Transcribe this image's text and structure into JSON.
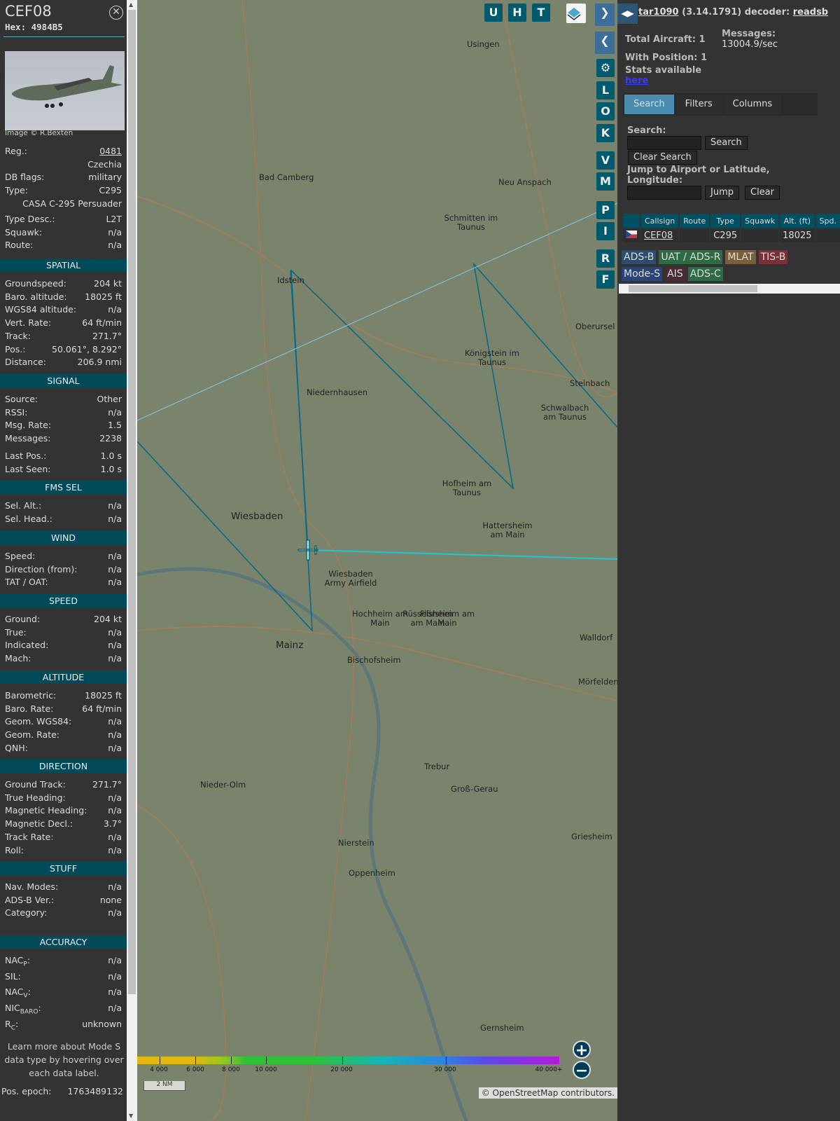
{
  "aircraft": {
    "callsign": "CEF08",
    "hex": "Hex: 4984B5",
    "image_credit": "Image © R.Bexten",
    "header_rows": [
      {
        "label": "Reg.:",
        "value": "0481",
        "link": true
      },
      {
        "label": "",
        "value": "Czechia"
      },
      {
        "label": "DB flags:",
        "value": "military"
      },
      {
        "label": "Type:",
        "value": "C295"
      },
      {
        "label": "",
        "value": "CASA C-295 Persuader"
      },
      {
        "label": "Type Desc.:",
        "value": "L2T"
      },
      {
        "label": "Squawk:",
        "value": "n/a"
      },
      {
        "label": "Route:",
        "value": "n/a"
      }
    ],
    "sections": [
      {
        "title": "SPATIAL",
        "rows": [
          {
            "label": "Groundspeed:",
            "value": "204 kt"
          },
          {
            "label": "Baro. altitude:",
            "value": "18025 ft"
          },
          {
            "label": "WGS84 altitude:",
            "value": "n/a"
          },
          {
            "label": "Vert. Rate:",
            "value": "64 ft/min"
          },
          {
            "label": "Track:",
            "value": "271.7°"
          },
          {
            "label": "Pos.:",
            "value": "50.061°, 8.292°"
          },
          {
            "label": "Distance:",
            "value": "206.9 nmi"
          }
        ]
      },
      {
        "title": "SIGNAL",
        "rows": [
          {
            "label": "Source:",
            "value": "Other"
          },
          {
            "label": "RSSI:",
            "value": "n/a"
          },
          {
            "label": "Msg. Rate:",
            "value": "1.5"
          },
          {
            "label": "Messages:",
            "value": "2238"
          },
          {
            "label": "Last Pos.:",
            "value": "1.0 s"
          },
          {
            "label": "Last Seen:",
            "value": "1.0 s"
          }
        ]
      },
      {
        "title": "FMS SEL",
        "rows": [
          {
            "label": "Sel. Alt.:",
            "value": "n/a"
          },
          {
            "label": "Sel. Head.:",
            "value": "n/a"
          }
        ]
      },
      {
        "title": "WIND",
        "rows": [
          {
            "label": "Speed:",
            "value": "n/a"
          },
          {
            "label": "Direction (from):",
            "value": "n/a"
          },
          {
            "label": "TAT / OAT:",
            "value": "n/a"
          }
        ]
      },
      {
        "title": "SPEED",
        "rows": [
          {
            "label": "Ground:",
            "value": "204 kt"
          },
          {
            "label": "True:",
            "value": "n/a"
          },
          {
            "label": "Indicated:",
            "value": "n/a"
          },
          {
            "label": "Mach:",
            "value": "n/a"
          }
        ]
      },
      {
        "title": "ALTITUDE",
        "rows": [
          {
            "label": "Barometric:",
            "value": "18025 ft"
          },
          {
            "label": "Baro. Rate:",
            "value": "64 ft/min"
          },
          {
            "label": "Geom. WGS84:",
            "value": "n/a"
          },
          {
            "label": "Geom. Rate:",
            "value": "n/a"
          },
          {
            "label": "QNH:",
            "value": "n/a"
          }
        ]
      },
      {
        "title": "DIRECTION",
        "rows": [
          {
            "label": "Ground Track:",
            "value": "271.7°"
          },
          {
            "label": "True Heading:",
            "value": "n/a"
          },
          {
            "label": "Magnetic Heading:",
            "value": "n/a"
          },
          {
            "label": "Magnetic Decl.:",
            "value": "3.7°"
          },
          {
            "label": "Track Rate:",
            "value": "n/a"
          },
          {
            "label": "Roll:",
            "value": "n/a"
          }
        ]
      },
      {
        "title": "STUFF",
        "rows": [
          {
            "label": "Nav. Modes:",
            "value": "n/a"
          },
          {
            "label": "ADS-B Ver.:",
            "value": "none"
          },
          {
            "label": "Category:",
            "value": "n/a"
          }
        ]
      },
      {
        "title": "ACCURACY",
        "rows": [
          {
            "label": "NAC",
            "sub": "P",
            "value": "n/a"
          },
          {
            "label": "SIL:",
            "value": "n/a"
          },
          {
            "label": "NAC",
            "sub": "V",
            "value": "n/a"
          },
          {
            "label": "NIC",
            "sub": "BARO",
            "value": "n/a"
          },
          {
            "label": "R",
            "sub": "C",
            "value": "unknown"
          }
        ]
      }
    ],
    "learn_more": "Learn more about Mode S data type by hovering over each data label.",
    "pos_epoch_label": "Pos. epoch:",
    "pos_epoch_value": "1763489132"
  },
  "map": {
    "top_buttons": [
      "U",
      "H",
      "T"
    ],
    "side_buttons": [
      "L",
      "O",
      "K",
      "V",
      "M",
      "P",
      "I",
      "R",
      "F"
    ],
    "towns": [
      {
        "name": "Usingen"
      },
      {
        "name": "Bad Camberg"
      },
      {
        "name": "Neu Anspach"
      },
      {
        "name": "Schmitten im Taunus"
      },
      {
        "name": "Idstein"
      },
      {
        "name": "Königstein im Taunus"
      },
      {
        "name": "Oberursel (Taunus)"
      },
      {
        "name": "Niedernhausen"
      },
      {
        "name": "Steinbach"
      },
      {
        "name": "Schwalbach am Taunus"
      },
      {
        "name": "Hofheim am Taunus"
      },
      {
        "name": "Hattersheim am Main"
      },
      {
        "name": "Wiesbaden"
      },
      {
        "name": "Wiesbaden Army Airfield"
      },
      {
        "name": "Hochheim am Main"
      },
      {
        "name": "Flörsheim am Main"
      },
      {
        "name": "Mainz"
      },
      {
        "name": "Bischofsheim"
      },
      {
        "name": "Rüsselsheim am Main"
      },
      {
        "name": "Walldorf"
      },
      {
        "name": "Mörfelden"
      },
      {
        "name": "Nieder-Olm"
      },
      {
        "name": "Trebur"
      },
      {
        "name": "Groß-Gerau"
      },
      {
        "name": "Nierstein"
      },
      {
        "name": "Oppenheim"
      },
      {
        "name": "Griesheim"
      },
      {
        "name": "Gernsheim"
      }
    ],
    "legend_labels": [
      "4 000",
      "6 000",
      "8 000",
      "10 000",
      "20 000",
      "30 000",
      "40 000+"
    ],
    "scale": "2 NM",
    "attribution": "© OpenStreetMap contributors."
  },
  "right": {
    "title_link": "tar1090",
    "version": "(3.14.1791) decoder:",
    "decoder": "readsb",
    "total_aircraft": "Total Aircraft: 1",
    "with_position": "With Position: 1",
    "messages_label": "Messages:",
    "messages_value": "13004.9/sec",
    "stats_available": "Stats available",
    "stats_link": "here",
    "tabs": [
      "Search",
      "Filters",
      "Columns"
    ],
    "search_label": "Search:",
    "search_button": "Search",
    "clear_search": "Clear Search",
    "jump_label": "Jump to Airport or Latitude, Longitude:",
    "jump_button": "Jump",
    "clear_button": "Clear",
    "table": {
      "headers": [
        "",
        "Callsign",
        "Route",
        "Type",
        "Squawk",
        "Alt. (ft)",
        "Spd."
      ],
      "rows": [
        {
          "flag": "Czechia",
          "callsign": "CEF08",
          "route": "",
          "type": "C295",
          "squawk": "",
          "alt": "18025",
          "spd": ""
        }
      ]
    },
    "badges": [
      {
        "label": "ADS-B",
        "color": "#2b4d6e"
      },
      {
        "label": "UAT / ADS-R",
        "color": "#2e6b45"
      },
      {
        "label": "MLAT",
        "color": "#7a5d3a"
      },
      {
        "label": "TIS-B",
        "color": "#7a3038"
      },
      {
        "label": "Mode-S",
        "color": "#2a4478"
      },
      {
        "label": "AIS",
        "color": "#4a2a35"
      },
      {
        "label": "ADS-C",
        "color": "#2e6b45"
      }
    ]
  }
}
